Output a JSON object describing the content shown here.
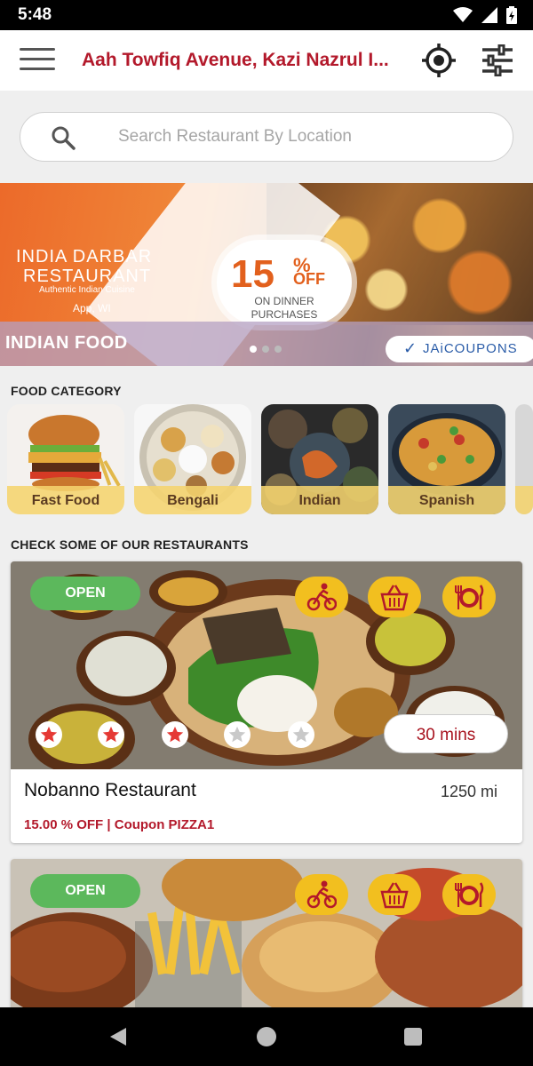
{
  "status_bar": {
    "time": "5:48"
  },
  "app_bar": {
    "location": "Aah Towfiq Avenue, Kazi Nazrul I...",
    "menu_icon": "hamburger-menu-icon",
    "locate_icon": "my-location-icon",
    "filter_icon": "filter-sliders-icon"
  },
  "search": {
    "placeholder": "Search Restaurant By Location"
  },
  "banner": {
    "restaurant_line1": "INDIA DARBAR",
    "restaurant_line2": "RESTAURANT",
    "cuisine": "Authentic Indian Cuisine",
    "place": "App, WI",
    "discount": "15",
    "discount_symbol": "%",
    "discount_off": "OFF",
    "discount_line1": "ON DINNER",
    "discount_line2": "PURCHASES",
    "caption": "INDIAN  FOOD",
    "brand": "JAiCOUPONS",
    "slide_count": 3,
    "active_slide": 1
  },
  "food_category": {
    "title": "FOOD CATEGORY",
    "items": [
      {
        "label": "Fast Food"
      },
      {
        "label": "Bengali"
      },
      {
        "label": "Indian"
      },
      {
        "label": "Spanish"
      }
    ]
  },
  "restaurants": {
    "title": "CHECK SOME OF OUR RESTAURANTS",
    "items": [
      {
        "status": "OPEN",
        "name": "Nobanno Restaurant",
        "distance": "1250 mi",
        "offer": "15.00 % OFF | Coupon PIZZA1",
        "delivery_time": "30 mins",
        "rating": 3,
        "rating_max": 5,
        "services": [
          "delivery-bike-icon",
          "basket-takeaway-icon",
          "dine-in-icon"
        ]
      },
      {
        "status": "OPEN",
        "services": [
          "delivery-bike-icon",
          "basket-takeaway-icon",
          "dine-in-icon"
        ]
      }
    ]
  },
  "colors": {
    "brand_red": "#b3192b",
    "open_green": "#5cb85c",
    "service_yellow": "#f2bf1f",
    "star_red": "#e53935"
  }
}
